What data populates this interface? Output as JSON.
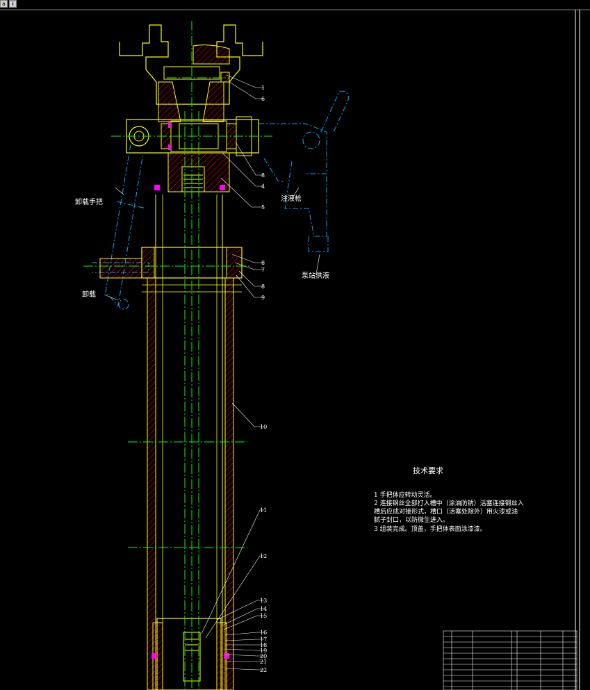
{
  "toolbar": {
    "icon_a": "a",
    "icon_b": "i"
  },
  "labels": {
    "unload_handle": "卸载手把",
    "unload": "卸载",
    "injection_gun": "注液枪",
    "pump_supply": "泵站供液"
  },
  "part_numbers": [
    "1",
    "6",
    "8",
    "4",
    "5",
    "8",
    "7",
    "8",
    "9",
    "10",
    "11",
    "12",
    "13",
    "14",
    "15",
    "16",
    "17",
    "18",
    "19",
    "20",
    "21",
    "22"
  ],
  "tech_requirements": {
    "title": "技术要求",
    "items": [
      "1  手把体应转动灵活。",
      "2  连接钢丝全部打入槽中（涂油防锈）活塞连接钢丝入",
      "    槽后应成对接形式，槽口（活塞处除外）用火漆或油",
      "    腻子封口，以防微生进入。",
      "3  组装完成。顶盖，手把体表面涂漆漆。"
    ]
  },
  "colors": {
    "background": "#000000",
    "outline": "#ffff00",
    "hatch": "#ff0000",
    "center_line": "#00ff00",
    "phantom": "#00aaff",
    "seal": "#ff00ff",
    "text": "#ffffff"
  }
}
